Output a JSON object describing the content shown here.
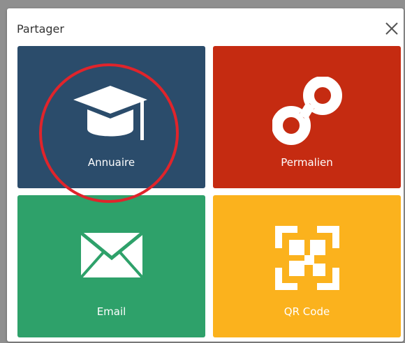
{
  "dialog": {
    "title": "Partager",
    "close_icon": "close-icon"
  },
  "tiles": [
    {
      "label": "Annuaire",
      "icon": "graduation-cap-icon",
      "color": "#2b4c6b"
    },
    {
      "label": "Permalien",
      "icon": "permalink-icon",
      "color": "#c52b11"
    },
    {
      "label": "Email",
      "icon": "envelope-icon",
      "color": "#2ea16a"
    },
    {
      "label": "QR Code",
      "icon": "qr-code-icon",
      "color": "#fbb21d"
    }
  ],
  "annotation": {
    "shape": "circle",
    "color": "#e0242b",
    "target": "Annuaire"
  }
}
